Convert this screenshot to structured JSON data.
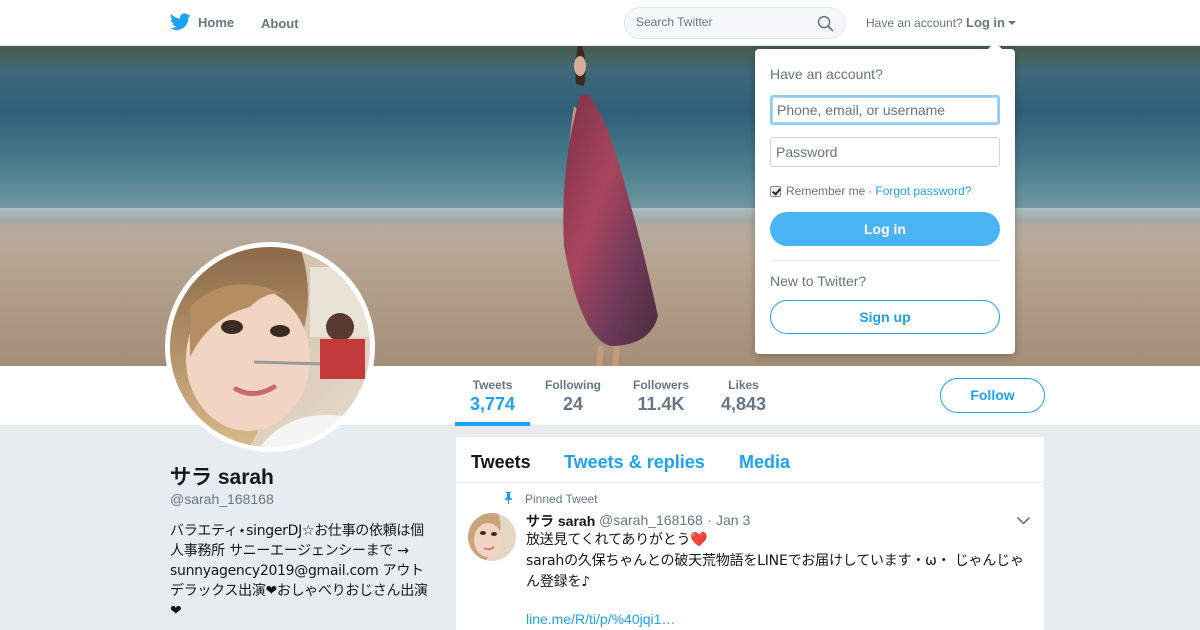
{
  "nav": {
    "home_label": "Home",
    "about_label": "About",
    "search_placeholder": "Search Twitter",
    "have_account": "Have an account?",
    "login_label": "Log in"
  },
  "stats": {
    "tweets_label": "Tweets",
    "tweets_value": "3,774",
    "following_label": "Following",
    "following_value": "24",
    "followers_label": "Followers",
    "followers_value": "11.4K",
    "likes_label": "Likes",
    "likes_value": "4,843"
  },
  "follow_label": "Follow",
  "profile": {
    "name": "サラ sarah",
    "handle": "@sarah_168168",
    "bio": "バラエティ⋆singerDJ☆お仕事の依頼は個人事務所 サニーエージェンシーまで → sunnyagency2019@gmail.com アウトデラックス出演❤おしゃべりおじさん出演❤"
  },
  "timeline": {
    "tabs": [
      "Tweets",
      "Tweets & replies",
      "Media"
    ],
    "active_tab": "Tweets"
  },
  "tweet": {
    "pinned_label": "Pinned Tweet",
    "name": "サラ sarah",
    "handle": "@sarah_168168",
    "separator": "·",
    "date": "Jan 3",
    "line1": "放送見てくれてありがとう",
    "heart": "❤️",
    "line2": "sarahの久保ちゃんとの破天荒物語をLINEでお届けしています・ω・ じゃんじゃん登録を♪",
    "link": "line.me/R/ti/p/%40jqi1…"
  },
  "login_dropdown": {
    "title": "Have an account?",
    "username_placeholder": "Phone, email, or username",
    "password_placeholder": "Password",
    "remember_label": "Remember me",
    "separator": "·",
    "forgot_label": "Forgot password?",
    "login_button": "Log in",
    "new_label": "New to Twitter?",
    "signup_button": "Sign up"
  },
  "colors": {
    "accent": "#1da1f2",
    "login_button": "#4ab3f4",
    "muted": "#657786",
    "background": "#e6ecf0"
  },
  "icons": [
    "twitter-bird-icon",
    "search-icon",
    "caret-down-icon",
    "pin-icon",
    "chevron-down-icon",
    "checkbox-checked-icon"
  ]
}
